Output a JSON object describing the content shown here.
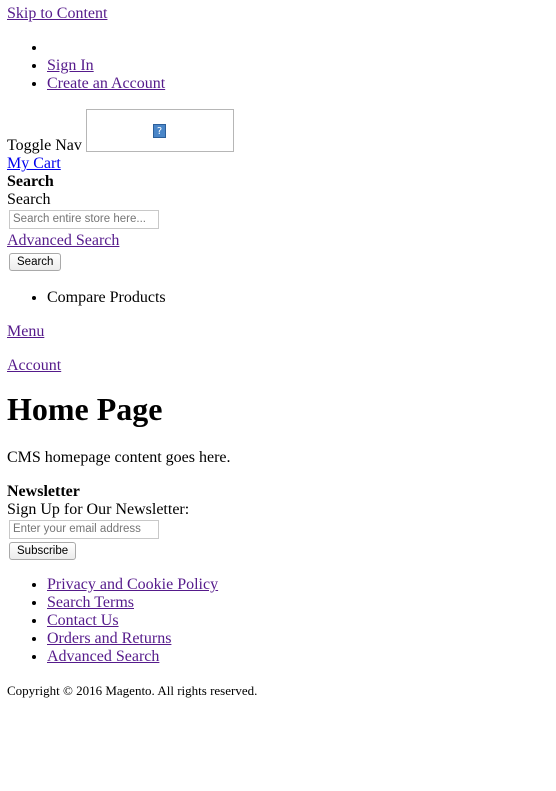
{
  "skip_link": "Skip to Content",
  "header_links": [
    {
      "label": ""
    },
    {
      "label": "Sign In"
    },
    {
      "label": "Create an Account"
    }
  ],
  "toggle_nav": "Toggle Nav",
  "logo_icon": "broken-image-icon",
  "logo_glyph": "?",
  "cart_link": "My Cart",
  "search": {
    "title": "Search",
    "label": "Search",
    "placeholder": "Search entire store here...",
    "advanced_link": "Advanced Search",
    "button": "Search"
  },
  "compare_products": "Compare Products",
  "menu_link": "Menu",
  "account_link": "Account",
  "page_title": "Home Page",
  "cms_content": "CMS homepage content goes here.",
  "newsletter": {
    "title": "Newsletter",
    "label": "Sign Up for Our Newsletter:",
    "placeholder": "Enter your email address",
    "button": "Subscribe"
  },
  "footer_links": [
    {
      "label": "Privacy and Cookie Policy"
    },
    {
      "label": "Search Terms"
    },
    {
      "label": "Contact Us"
    },
    {
      "label": "Orders and Returns"
    },
    {
      "label": "Advanced Search"
    }
  ],
  "copyright": "Copyright © 2016 Magento. All rights reserved.",
  "colors": {
    "visited_link": "#551a8b",
    "unvisited_link": "#0000ee"
  }
}
